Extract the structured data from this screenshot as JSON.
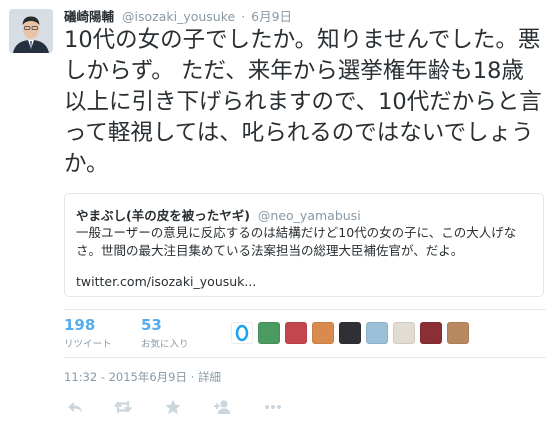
{
  "tweet": {
    "author_name": "礒崎陽輔",
    "author_handle": "@isozaki_yousuke",
    "separator": "·",
    "date": "6月9日",
    "text": "10代の女の子でしたか。知りませんでした。悪しからず。 ただ、来年から選挙権年齢も18歳以上に引き下げられますので、10代だからと言って軽視しては、叱られるのではないでしょうか。"
  },
  "quoted": {
    "author_name": "やまぶし(羊の皮を被ったヤギ)",
    "author_handle": "@neo_yamabusi",
    "text": "一般ユーザーの意見に反応するのは結構だけど10代の女の子に、この大人げなさ。世間の最大注目集めている法案担当の総理大臣補佐官が、だよ。",
    "link": "twitter.com/isozaki_yousuk..."
  },
  "stats": {
    "retweets_count": "198",
    "retweets_label": "リツイート",
    "favorites_count": "53",
    "favorites_label": "お気に入り"
  },
  "footer": {
    "timestamp": "11:32 - 2015年6月9日",
    "separator": "·",
    "details_label": "詳細"
  },
  "icons": [
    "reply-icon",
    "retweet-icon",
    "favorite-icon",
    "follow-icon",
    "more-icon"
  ],
  "colors": {
    "link_blue": "#55acee",
    "text": "#292f33",
    "muted": "#8899a6",
    "border": "#e1e8ed",
    "action_gray": "#ccd6dd"
  }
}
